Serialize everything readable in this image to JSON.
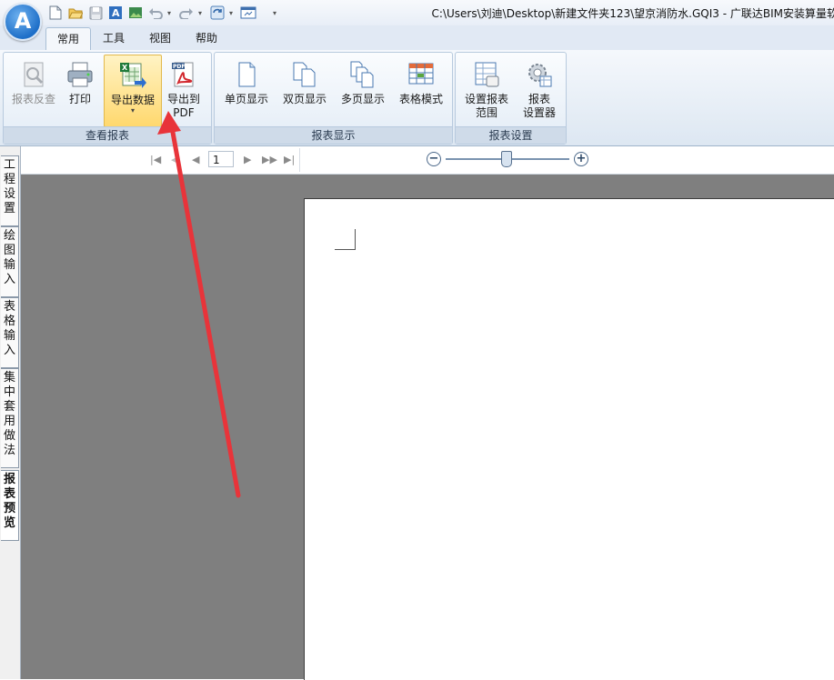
{
  "window": {
    "title": "C:\\Users\\刘迪\\Desktop\\新建文件夹123\\望京消防水.GQI3 - 广联达BIM安装算量软"
  },
  "app_logo": {
    "letter": "A",
    "icon": "app-logo-icon"
  },
  "quick_access": [
    {
      "name": "new-file-icon"
    },
    {
      "name": "open-folder-icon"
    },
    {
      "name": "save-icon"
    },
    {
      "name": "export-a-icon"
    },
    {
      "name": "image-icon"
    },
    {
      "name": "undo-icon"
    },
    {
      "name": "redo-icon"
    },
    {
      "name": "refresh-icon"
    },
    {
      "name": "window-icon"
    }
  ],
  "tabs": [
    {
      "label": "常用",
      "active": true
    },
    {
      "label": "工具",
      "active": false
    },
    {
      "label": "视图",
      "active": false
    },
    {
      "label": "帮助",
      "active": false
    }
  ],
  "ribbon": {
    "groups": [
      {
        "label": "查看报表",
        "buttons": [
          {
            "label": "报表反查",
            "icon": "report-lookup-icon",
            "disabled": true
          },
          {
            "label": "打印",
            "icon": "printer-icon"
          },
          {
            "label": "导出数据",
            "icon": "excel-export-icon",
            "highlight": true
          },
          {
            "label_line1": "导出到",
            "label_line2": "PDF",
            "icon": "pdf-icon"
          }
        ]
      },
      {
        "label": "报表显示",
        "buttons": [
          {
            "label": "单页显示",
            "icon": "single-page-icon"
          },
          {
            "label": "双页显示",
            "icon": "double-page-icon"
          },
          {
            "label": "多页显示",
            "icon": "multi-page-icon"
          },
          {
            "label": "表格模式",
            "icon": "table-mode-icon"
          }
        ]
      },
      {
        "label": "报表设置",
        "buttons": [
          {
            "label_line1": "设置报表",
            "label_line2": "范围",
            "icon": "report-range-icon"
          },
          {
            "label_line1": "报表",
            "label_line2": "设置器",
            "icon": "report-settings-gear-icon"
          }
        ]
      }
    ]
  },
  "left_tabs": [
    {
      "label": "工程设置"
    },
    {
      "label": "绘图输入"
    },
    {
      "label": "表格输入"
    },
    {
      "label": "集中套用做法"
    },
    {
      "label": "报表预览",
      "active": true
    }
  ],
  "preview_toolbar": {
    "page_number": "1"
  },
  "colors": {
    "ribbon_highlight": "#ffd86e",
    "canvas_bg": "#7f7f7f",
    "annotation_arrow": "#e8343a"
  }
}
